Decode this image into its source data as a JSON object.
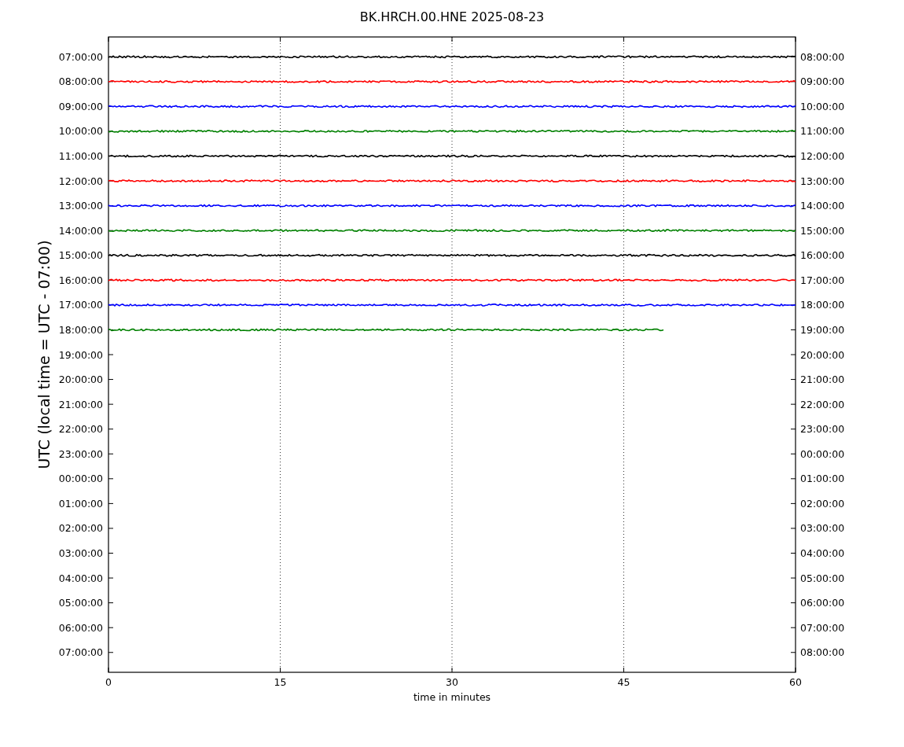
{
  "title": "BK.HRCH.00.HNE 2025-08-23",
  "ylabel": "UTC (local time = UTC - 07:00)",
  "xlabel": "time in minutes",
  "xticks": [
    "0",
    "15",
    "30",
    "45",
    "60"
  ],
  "left_ticks": [
    "07:00:00",
    "08:00:00",
    "09:00:00",
    "10:00:00",
    "11:00:00",
    "12:00:00",
    "13:00:00",
    "14:00:00",
    "15:00:00",
    "16:00:00",
    "17:00:00",
    "18:00:00",
    "19:00:00",
    "20:00:00",
    "21:00:00",
    "22:00:00",
    "23:00:00",
    "00:00:00",
    "01:00:00",
    "02:00:00",
    "03:00:00",
    "04:00:00",
    "05:00:00",
    "06:00:00",
    "07:00:00"
  ],
  "right_ticks": [
    "08:00:00",
    "09:00:00",
    "10:00:00",
    "11:00:00",
    "12:00:00",
    "13:00:00",
    "14:00:00",
    "15:00:00",
    "16:00:00",
    "17:00:00",
    "18:00:00",
    "19:00:00",
    "20:00:00",
    "21:00:00",
    "22:00:00",
    "23:00:00",
    "00:00:00",
    "01:00:00",
    "02:00:00",
    "03:00:00",
    "04:00:00",
    "05:00:00",
    "06:00:00",
    "07:00:00",
    "08:00:00"
  ],
  "traces": [
    {
      "color": "#000000",
      "level": 1
    },
    {
      "color": "#ff0000",
      "level": 1
    },
    {
      "color": "#0000ff",
      "level": 1
    },
    {
      "color": "#008000",
      "level": 1
    },
    {
      "color": "#000000",
      "level": 1
    },
    {
      "color": "#ff0000",
      "level": 1
    },
    {
      "color": "#0000ff",
      "level": 1
    },
    {
      "color": "#008000",
      "level": 1
    },
    {
      "color": "#000000",
      "level": 1
    },
    {
      "color": "#ff0000",
      "level": 1
    },
    {
      "color": "#0000ff",
      "level": 1
    },
    {
      "color": "#008000",
      "level": 0.81
    }
  ]
}
